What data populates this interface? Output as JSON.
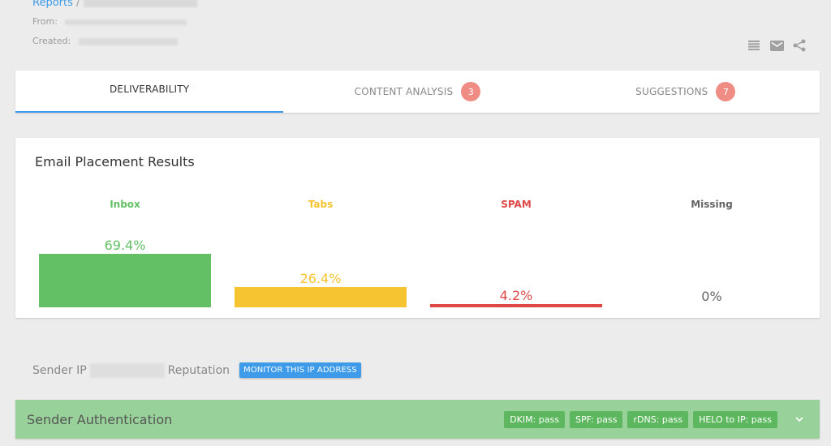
{
  "header": {
    "breadcrumb_root": "Reports",
    "breadcrumb_separator": "/",
    "from_label": "From:",
    "created_label": "Created:"
  },
  "actions": [
    {
      "name": "list-icon"
    },
    {
      "name": "email-icon"
    },
    {
      "name": "share-icon"
    }
  ],
  "tabs": [
    {
      "label": "DELIVERABILITY",
      "active": true,
      "badge": null
    },
    {
      "label": "CONTENT ANALYSIS",
      "active": false,
      "badge": "3"
    },
    {
      "label": "SUGGESTIONS",
      "active": false,
      "badge": "7"
    }
  ],
  "results": {
    "title": "Email Placement Results"
  },
  "chart_data": {
    "type": "bar",
    "title": "Email Placement Results",
    "categories": [
      "Inbox",
      "Tabs",
      "SPAM",
      "Missing"
    ],
    "values": [
      69.4,
      26.4,
      4.2,
      0
    ],
    "labels": [
      "69.4%",
      "26.4%",
      "4.2%",
      "0%"
    ],
    "colors": [
      "#63c065",
      "#f7c431",
      "#e04848",
      "#888888"
    ],
    "label_colors": [
      "#63c065",
      "#f7c431",
      "#e04848",
      "#666666"
    ],
    "ylim": [
      0,
      100
    ],
    "xlabel": "",
    "ylabel": "",
    "grid": false
  },
  "sender_ip": {
    "prefix": "Sender IP",
    "suffix": "Reputation",
    "monitor_button": "MONITOR THIS IP ADDRESS"
  },
  "auth": {
    "title": "Sender Authentication",
    "badges": [
      "DKIM: pass",
      "SPF: pass",
      "rDNS: pass",
      "HELO to IP: pass"
    ]
  },
  "colors": {
    "accent": "#3d9be9",
    "badge": "#ef8d85",
    "auth_bg": "#98d29a",
    "auth_badge": "#5cb75e"
  }
}
